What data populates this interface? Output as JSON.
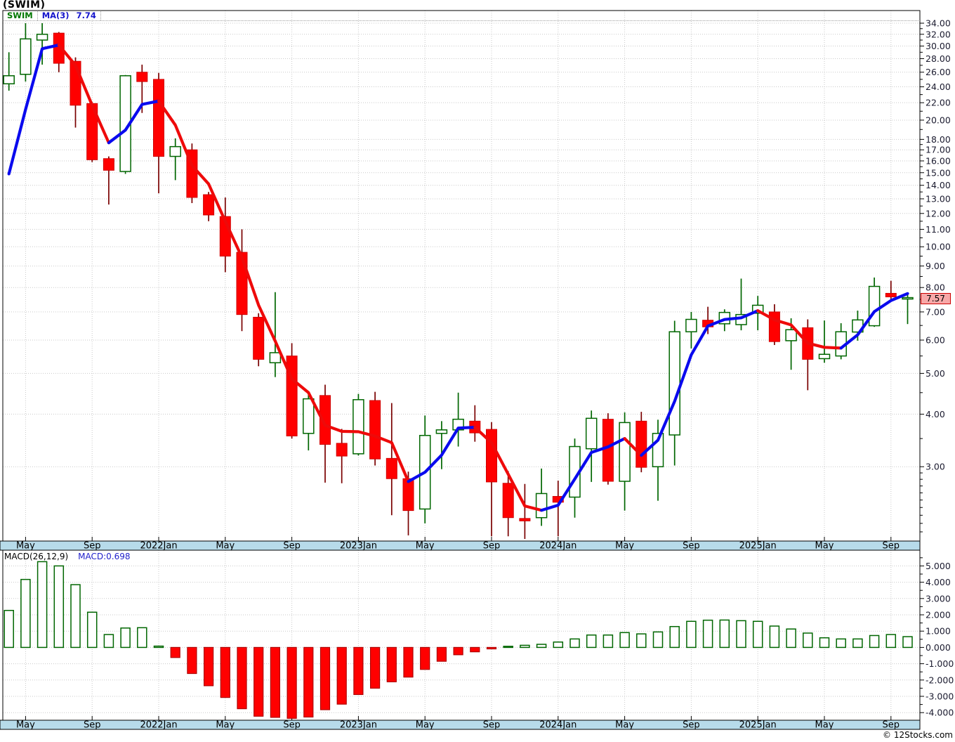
{
  "header": {
    "title": "(SWIM)"
  },
  "legend": {
    "symbol": "SWIM",
    "ma_label": "MA(3)",
    "ma_value": "7.74"
  },
  "macd_legend": {
    "label": "MACD(26,12,9)",
    "value_label": "MACD:0.698"
  },
  "price_tag": "7.57",
  "footer": {
    "copyright": "© 12Stocks.com"
  },
  "colors": {
    "up": "#006600",
    "up_fill": "#ffffff",
    "down_fill": "#ff0000",
    "down_stroke": "#d00000",
    "wick_down": "#7a0000",
    "ma_up": "#0a0aee",
    "ma_down": "#ee0a0a",
    "grid": "#c9c9c9",
    "axis_text": "#1b1b2f",
    "strip_bg": "#b7dbea",
    "macd_pos": "#006600",
    "macd_neg_fill": "#ff0000",
    "macd_neg_stroke": "#b00000"
  },
  "chart_data": {
    "type": "candlestick+macd-histogram",
    "symbol": "SWIM",
    "ma_period": 3,
    "ma_seed": [
      14.9,
      21.2
    ],
    "last_price": 7.57,
    "price_axis": {
      "scale": "log",
      "labeled": [
        34,
        32,
        30,
        28,
        26,
        24,
        22,
        20,
        18,
        17,
        16,
        15,
        14,
        13,
        12,
        11,
        10,
        9,
        8,
        7,
        6,
        5,
        4,
        3
      ],
      "minor": [
        33,
        31,
        29,
        27,
        25,
        23,
        21,
        19,
        17.5,
        16.5,
        15.5,
        14.5,
        13.5,
        12.5,
        11.5,
        10.5,
        9.5,
        8.5,
        7.5,
        6.5,
        5.5,
        4.5,
        3.5,
        2.9,
        2.8,
        2.7,
        2.6,
        2.5,
        2.4,
        2.3,
        2.2,
        2.1
      ]
    },
    "macd_axis": {
      "labeled": [
        5,
        4,
        3,
        2,
        1,
        0,
        -1,
        -2,
        -3,
        -4
      ],
      "minor": [
        5.5,
        4.5,
        3.5,
        2.5,
        1.5,
        0.5,
        -0.5,
        -1.5,
        -2.5,
        -3.5
      ]
    },
    "x_labels": [
      {
        "i": 1,
        "label": "May"
      },
      {
        "i": 5,
        "label": "Sep"
      },
      {
        "i": 9,
        "label": "2022Jan"
      },
      {
        "i": 13,
        "label": "May"
      },
      {
        "i": 17,
        "label": "Sep"
      },
      {
        "i": 21,
        "label": "2023Jan"
      },
      {
        "i": 25,
        "label": "May"
      },
      {
        "i": 29,
        "label": "Sep"
      },
      {
        "i": 33,
        "label": "2024Jan"
      },
      {
        "i": 37,
        "label": "May"
      },
      {
        "i": 41,
        "label": "Sep"
      },
      {
        "i": 45,
        "label": "2025Jan"
      },
      {
        "i": 49,
        "label": "May"
      },
      {
        "i": 53,
        "label": "Sep"
      }
    ],
    "candles": [
      {
        "t": "2021-04",
        "o": 24.4,
        "h": 29.0,
        "l": 23.5,
        "c": 25.5,
        "macd": 2.27
      },
      {
        "t": "2021-05",
        "o": 25.7,
        "h": 34.0,
        "l": 24.7,
        "c": 31.2,
        "macd": 4.17
      },
      {
        "t": "2021-06",
        "o": 31.0,
        "h": 34.0,
        "l": 27.1,
        "c": 32.0,
        "macd": 5.26
      },
      {
        "t": "2021-07",
        "o": 32.2,
        "h": 32.4,
        "l": 26.0,
        "c": 27.3,
        "macd": 5.0
      },
      {
        "t": "2021-08",
        "o": 27.6,
        "h": 28.2,
        "l": 19.2,
        "c": 21.7,
        "macd": 3.85
      },
      {
        "t": "2021-09",
        "o": 21.9,
        "h": 22.1,
        "l": 15.9,
        "c": 16.1,
        "macd": 2.16
      },
      {
        "t": "2021-10",
        "o": 16.2,
        "h": 16.4,
        "l": 12.6,
        "c": 15.2,
        "macd": 0.79
      },
      {
        "t": "2021-11",
        "o": 15.1,
        "h": 25.6,
        "l": 14.9,
        "c": 25.5,
        "macd": 1.19
      },
      {
        "t": "2021-12",
        "o": 26.0,
        "h": 27.1,
        "l": 20.8,
        "c": 24.7,
        "macd": 1.21
      },
      {
        "t": "2022-01",
        "o": 25.0,
        "h": 25.9,
        "l": 13.4,
        "c": 16.4,
        "macd": 0.08
      },
      {
        "t": "2022-02",
        "o": 16.4,
        "h": 18.1,
        "l": 14.4,
        "c": 17.3,
        "macd": -0.62
      },
      {
        "t": "2022-03",
        "o": 17.0,
        "h": 17.6,
        "l": 12.7,
        "c": 13.1,
        "macd": -1.6
      },
      {
        "t": "2022-04",
        "o": 13.3,
        "h": 13.5,
        "l": 11.5,
        "c": 11.9,
        "macd": -2.35
      },
      {
        "t": "2022-05",
        "o": 11.8,
        "h": 13.1,
        "l": 8.7,
        "c": 9.5,
        "macd": -3.07
      },
      {
        "t": "2022-06",
        "o": 9.7,
        "h": 11.0,
        "l": 6.3,
        "c": 6.9,
        "macd": -3.76
      },
      {
        "t": "2022-07",
        "o": 6.8,
        "h": 6.95,
        "l": 5.2,
        "c": 5.4,
        "macd": -4.22
      },
      {
        "t": "2022-08",
        "o": 5.3,
        "h": 7.8,
        "l": 4.9,
        "c": 5.6,
        "macd": -4.29
      },
      {
        "t": "2022-09",
        "o": 5.5,
        "h": 5.9,
        "l": 3.5,
        "c": 3.55,
        "macd": -4.35
      },
      {
        "t": "2022-10",
        "o": 3.6,
        "h": 4.5,
        "l": 3.28,
        "c": 4.35,
        "macd": -4.27
      },
      {
        "t": "2022-11",
        "o": 4.43,
        "h": 4.7,
        "l": 2.75,
        "c": 3.39,
        "macd": -3.82
      },
      {
        "t": "2022-12",
        "o": 3.41,
        "h": 3.69,
        "l": 2.74,
        "c": 3.18,
        "macd": -3.48
      },
      {
        "t": "2023-01",
        "o": 3.22,
        "h": 4.47,
        "l": 3.19,
        "c": 4.33,
        "macd": -2.89
      },
      {
        "t": "2023-02",
        "o": 4.31,
        "h": 4.52,
        "l": 3.02,
        "c": 3.13,
        "macd": -2.5
      },
      {
        "t": "2023-03",
        "o": 3.14,
        "h": 4.25,
        "l": 2.3,
        "c": 2.81,
        "macd": -2.11
      },
      {
        "t": "2023-04",
        "o": 2.81,
        "h": 2.92,
        "l": 2.06,
        "c": 2.36,
        "macd": -1.82
      },
      {
        "t": "2023-05",
        "o": 2.38,
        "h": 3.97,
        "l": 2.2,
        "c": 3.56,
        "macd": -1.35
      },
      {
        "t": "2023-06",
        "o": 3.6,
        "h": 3.85,
        "l": 2.96,
        "c": 3.67,
        "macd": -0.85
      },
      {
        "t": "2023-07",
        "o": 3.67,
        "h": 4.5,
        "l": 3.35,
        "c": 3.89,
        "macd": -0.45
      },
      {
        "t": "2023-08",
        "o": 3.85,
        "h": 4.2,
        "l": 3.44,
        "c": 3.61,
        "macd": -0.27
      },
      {
        "t": "2023-09",
        "o": 3.68,
        "h": 3.83,
        "l": 2.05,
        "c": 2.76,
        "macd": -0.09
      },
      {
        "t": "2023-10",
        "o": 2.74,
        "h": 2.93,
        "l": 2.05,
        "c": 2.27,
        "macd": 0.03
      },
      {
        "t": "2023-11",
        "o": 2.26,
        "h": 2.73,
        "l": 2.02,
        "c": 2.23,
        "macd": 0.13
      },
      {
        "t": "2023-12",
        "o": 2.27,
        "h": 2.97,
        "l": 2.17,
        "c": 2.59,
        "macd": 0.19
      },
      {
        "t": "2024-01",
        "o": 2.55,
        "h": 2.78,
        "l": 2.05,
        "c": 2.47,
        "macd": 0.33
      },
      {
        "t": "2024-02",
        "o": 2.54,
        "h": 3.5,
        "l": 2.27,
        "c": 3.35,
        "macd": 0.52
      },
      {
        "t": "2024-03",
        "o": 3.31,
        "h": 4.08,
        "l": 2.76,
        "c": 3.91,
        "macd": 0.76
      },
      {
        "t": "2024-04",
        "o": 3.89,
        "h": 4.02,
        "l": 2.72,
        "c": 2.77,
        "macd": 0.76
      },
      {
        "t": "2024-05",
        "o": 2.77,
        "h": 4.04,
        "l": 2.36,
        "c": 3.82,
        "macd": 0.91
      },
      {
        "t": "2024-06",
        "o": 3.85,
        "h": 4.05,
        "l": 2.91,
        "c": 2.99,
        "macd": 0.83
      },
      {
        "t": "2024-07",
        "o": 3.0,
        "h": 3.88,
        "l": 2.49,
        "c": 3.6,
        "macd": 0.95
      },
      {
        "t": "2024-08",
        "o": 3.57,
        "h": 6.67,
        "l": 3.02,
        "c": 6.28,
        "macd": 1.28
      },
      {
        "t": "2024-09",
        "o": 6.28,
        "h": 7.0,
        "l": 5.73,
        "c": 6.72,
        "macd": 1.6
      },
      {
        "t": "2024-10",
        "o": 6.69,
        "h": 7.2,
        "l": 6.2,
        "c": 6.45,
        "macd": 1.67
      },
      {
        "t": "2024-11",
        "o": 6.56,
        "h": 7.1,
        "l": 6.3,
        "c": 6.98,
        "macd": 1.68
      },
      {
        "t": "2024-12",
        "o": 6.53,
        "h": 8.4,
        "l": 6.33,
        "c": 6.9,
        "macd": 1.64
      },
      {
        "t": "2025-01",
        "o": 6.95,
        "h": 7.64,
        "l": 6.33,
        "c": 7.26,
        "macd": 1.6
      },
      {
        "t": "2025-02",
        "o": 7.0,
        "h": 7.3,
        "l": 5.84,
        "c": 5.95,
        "macd": 1.31
      },
      {
        "t": "2025-03",
        "o": 5.98,
        "h": 6.76,
        "l": 5.1,
        "c": 6.35,
        "macd": 1.13
      },
      {
        "t": "2025-04",
        "o": 6.42,
        "h": 6.72,
        "l": 4.56,
        "c": 5.4,
        "macd": 0.88
      },
      {
        "t": "2025-05",
        "o": 5.42,
        "h": 6.68,
        "l": 5.3,
        "c": 5.55,
        "macd": 0.59
      },
      {
        "t": "2025-06",
        "o": 5.5,
        "h": 6.58,
        "l": 5.4,
        "c": 6.28,
        "macd": 0.52
      },
      {
        "t": "2025-07",
        "o": 6.27,
        "h": 7.05,
        "l": 5.98,
        "c": 6.7,
        "macd": 0.52
      },
      {
        "t": "2025-08",
        "o": 6.49,
        "h": 8.45,
        "l": 6.45,
        "c": 8.05,
        "macd": 0.73
      },
      {
        "t": "2025-09",
        "o": 7.75,
        "h": 8.3,
        "l": 7.4,
        "c": 7.6,
        "macd": 0.79
      },
      {
        "t": "2025-10",
        "o": 7.55,
        "h": 7.78,
        "l": 6.55,
        "c": 7.57,
        "macd": 0.66
      }
    ]
  }
}
